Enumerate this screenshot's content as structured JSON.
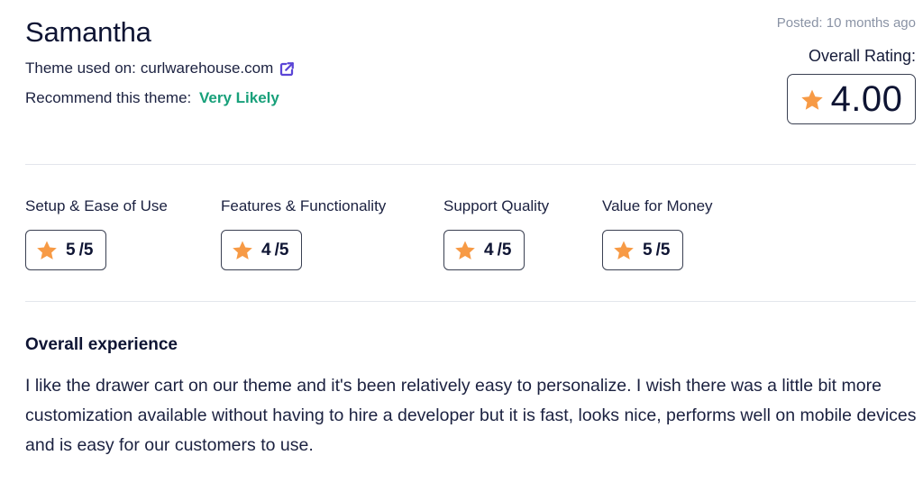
{
  "reviewer": {
    "name": "Samantha",
    "theme_used_label": "Theme used on:",
    "theme_used_site": "curlwarehouse.com",
    "theme_used_icon": "external-link-icon",
    "recommend_label": "Recommend this theme:",
    "recommend_value": "Very Likely"
  },
  "meta": {
    "posted": "Posted: 10 months ago",
    "overall_label": "Overall Rating:",
    "overall_value": "4.00",
    "star_icon": "star-icon"
  },
  "colors": {
    "star": "#F79A45",
    "accent_green": "#18A07A",
    "link_icon": "#5B45D6",
    "text_dark": "#0E1433",
    "muted": "#8A93A5",
    "divider": "#E3E6EC"
  },
  "categories": [
    {
      "label": "Setup & Ease of Use",
      "score": "5",
      "max": "/5"
    },
    {
      "label": "Features & Functionality",
      "score": "4",
      "max": "/5"
    },
    {
      "label": "Support Quality",
      "score": "4",
      "max": "/5"
    },
    {
      "label": "Value for Money",
      "score": "5",
      "max": "/5"
    }
  ],
  "experience": {
    "title": "Overall experience",
    "body": "I like the drawer cart on our theme and it's been relatively easy to personalize. I wish there was a little bit more customization available without having to hire a developer but it is fast, looks nice, performs well on mobile devices and is easy for our customers to use."
  }
}
